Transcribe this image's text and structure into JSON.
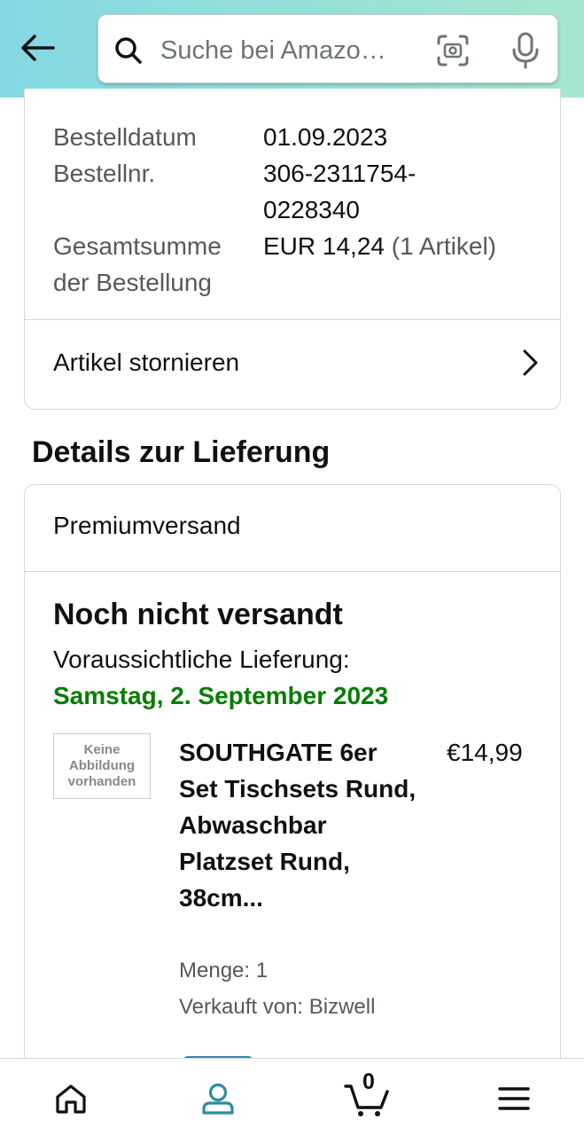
{
  "header": {
    "search_placeholder": "Suche bei Amazo…"
  },
  "order": {
    "date_label": "Bestelldatum",
    "date_value": "01.09.2023",
    "number_label": "Bestellnr.",
    "number_value": "306-2311754-0228340",
    "total_label": "Gesamtsumme der Bestellung",
    "total_value": "EUR 14,24",
    "total_items": "(1 Artikel)",
    "cancel_label": "Artikel stornieren"
  },
  "delivery": {
    "section_title": "Details zur Lieferung",
    "shipping_type": "Premiumversand",
    "status": "Noch nicht versandt",
    "estimate_label": "Voraussichtliche Lieferung:",
    "estimate_date": "Samstag, 2. September 2023",
    "estimate_color": "#067d00"
  },
  "product": {
    "image_placeholder": "Keine\nAbbildung\nvorhanden",
    "title": "SOUTHGATE 6er Set Tischsets Rund, Abwaschbar Platzset Rund, 38cm...",
    "price": "€14,99",
    "quantity": "Menge: 1",
    "seller": "Verkauft von: Bizwell"
  },
  "bottom_nav": {
    "active": "account",
    "active_color": "#2f8ca0",
    "cart_count": "0",
    "items": [
      "home-icon",
      "account-icon",
      "cart-icon",
      "menu-icon"
    ]
  }
}
